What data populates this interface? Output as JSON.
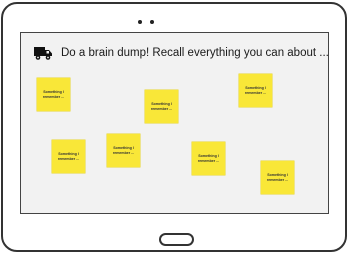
{
  "prompt": {
    "text": "Do a brain dump! Recall everything you can about ...",
    "icon": "truck-icon"
  },
  "notes": [
    {
      "line1": "Something I",
      "line2": "remember ..."
    },
    {
      "line1": "Something I",
      "line2": "remember ..."
    },
    {
      "line1": "Something I",
      "line2": "remember ..."
    },
    {
      "line1": "Something I",
      "line2": "remember ..."
    },
    {
      "line1": "Something I",
      "line2": "remember ..."
    },
    {
      "line1": "Something I",
      "line2": "remember ..."
    },
    {
      "line1": "Something I",
      "line2": "remember ..."
    }
  ],
  "colors": {
    "note": "#f9e738",
    "frame": "#333333",
    "screen": "#f2f2f2"
  }
}
